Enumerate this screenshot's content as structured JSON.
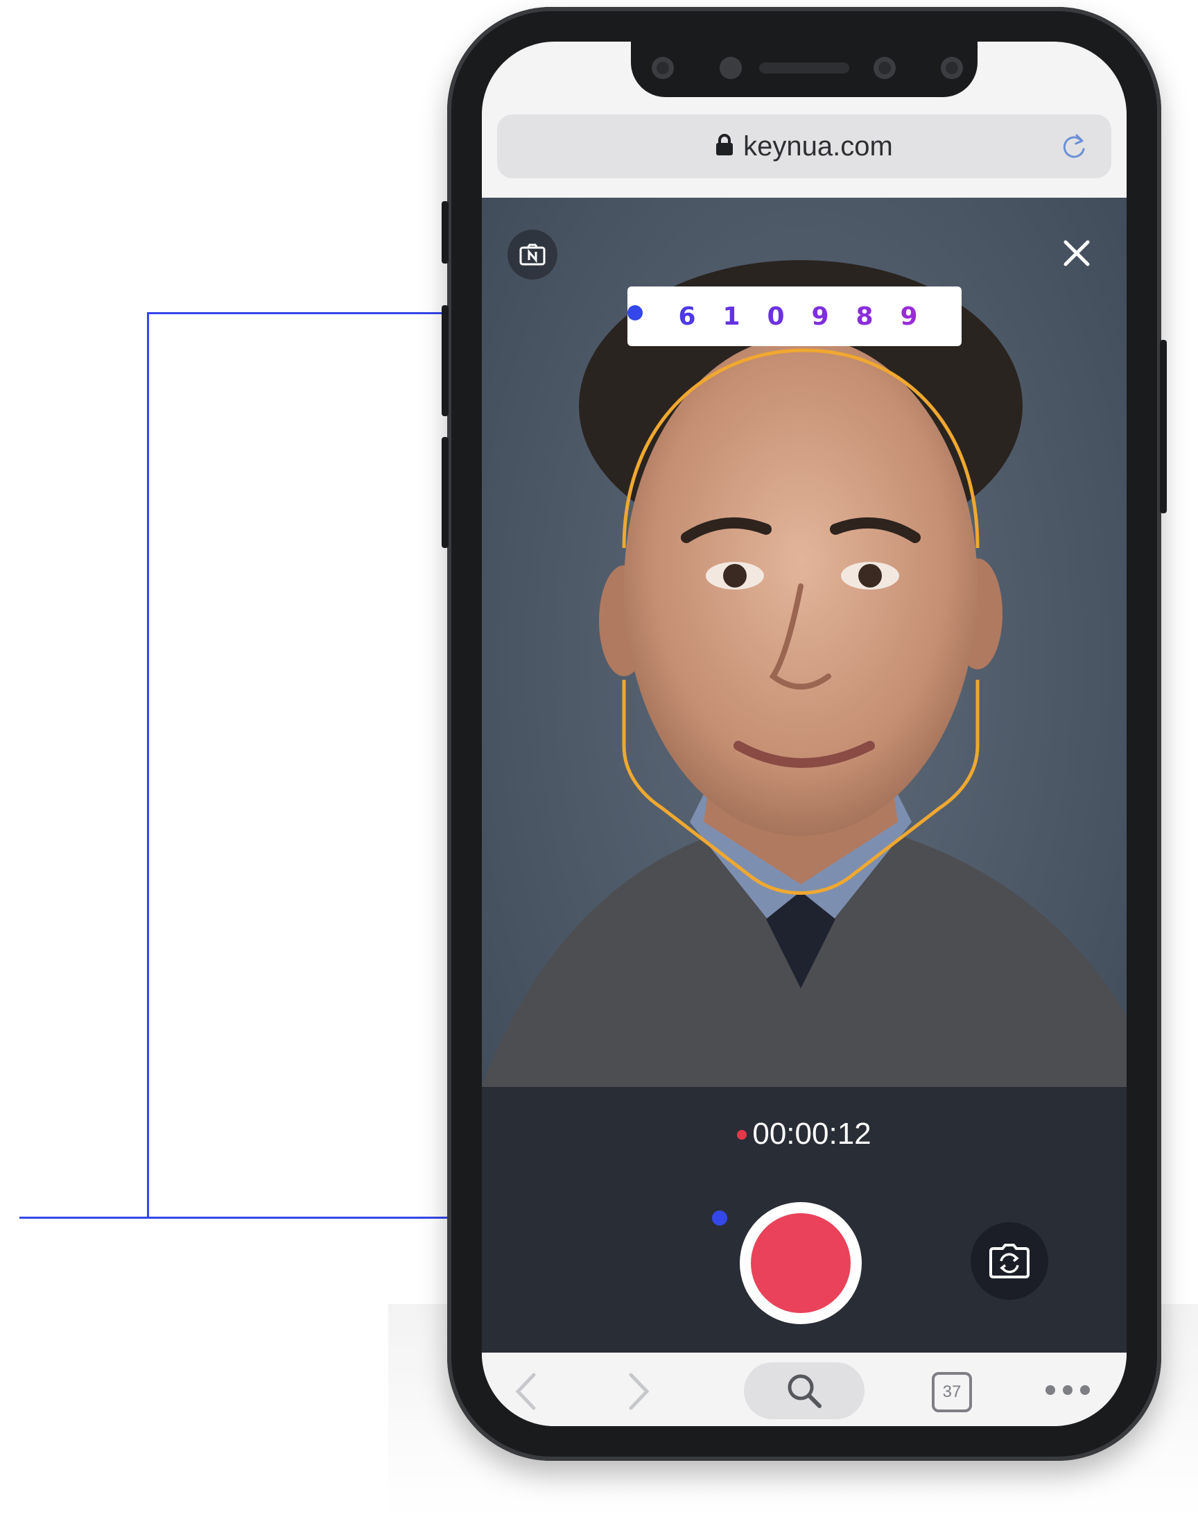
{
  "browser": {
    "url": "keynua.com",
    "tab_count": "37"
  },
  "verification": {
    "code_digits": [
      "6",
      "1",
      "0",
      "9",
      "8",
      "9"
    ]
  },
  "recorder": {
    "timer": "00:00:12",
    "state": "recording"
  },
  "icons": {
    "id_card": "id-card-icon",
    "close": "close-icon",
    "record": "record-icon",
    "flip_camera": "flip-camera-icon",
    "lock": "lock-icon",
    "reload": "reload-icon",
    "back": "chevron-left-icon",
    "forward": "chevron-right-icon",
    "search": "search-icon",
    "more": "more-icon"
  },
  "colors": {
    "annotation_line": "#3447e8",
    "face_guide": "#f0a830",
    "record_button": "#e9425a",
    "code_gradient_start": "#4e39e6",
    "code_gradient_end": "#9a2bd8"
  }
}
